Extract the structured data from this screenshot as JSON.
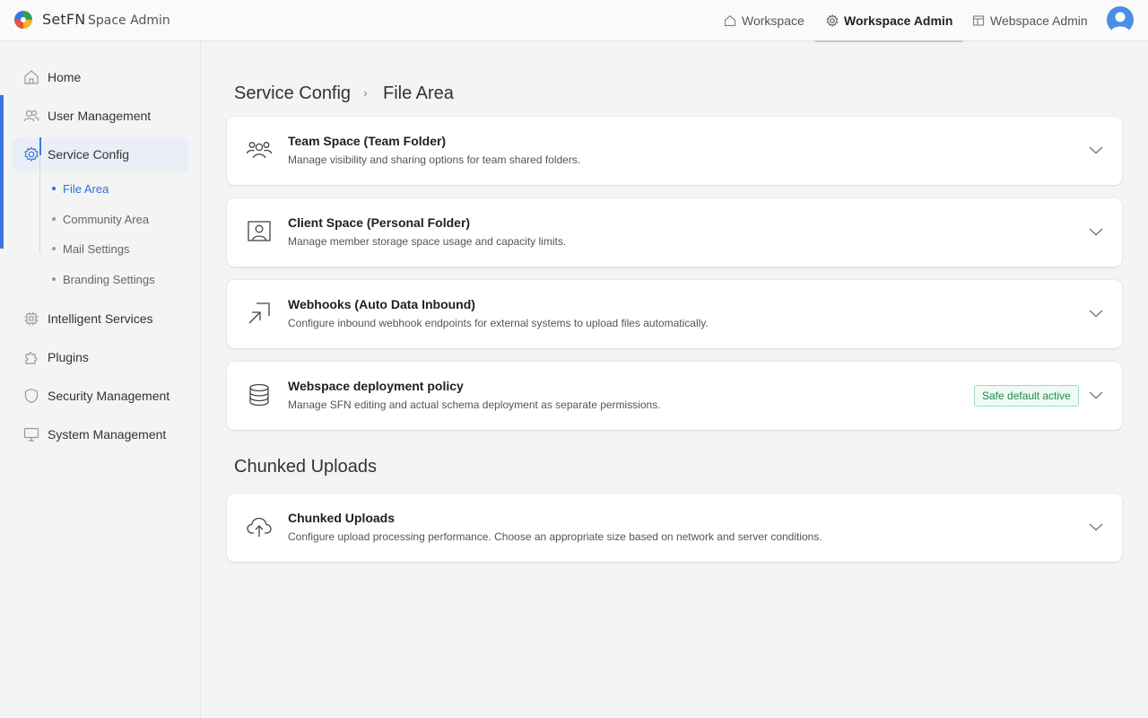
{
  "header": {
    "brand": "SetFN",
    "subtitle": "Space Admin",
    "nav": [
      {
        "label": "Workspace",
        "icon": "home-icon",
        "active": false
      },
      {
        "label": "Workspace Admin",
        "icon": "gear-icon",
        "active": true
      },
      {
        "label": "Webspace Admin",
        "icon": "layout-icon",
        "active": false
      }
    ],
    "avatar_icon": "user-avatar-icon"
  },
  "sidebar": {
    "items": [
      {
        "label": "Home",
        "icon": "home-icon"
      },
      {
        "label": "User Management",
        "icon": "users-icon"
      },
      {
        "label": "Service Config",
        "icon": "gear-icon",
        "active": true
      },
      {
        "label": "Intelligent Services",
        "icon": "chip-icon"
      },
      {
        "label": "Plugins",
        "icon": "puzzle-icon"
      },
      {
        "label": "Security Management",
        "icon": "shield-icon"
      },
      {
        "label": "System Management",
        "icon": "monitor-icon"
      }
    ],
    "sub_items": [
      {
        "label": "File Area",
        "active": true
      },
      {
        "label": "Community Area"
      },
      {
        "label": "Mail Settings"
      },
      {
        "label": "Branding Settings"
      }
    ]
  },
  "breadcrumb": {
    "parent": "Service Config",
    "separator": "›",
    "current": "File Area"
  },
  "cards": [
    {
      "title": "Team Space (Team Folder)",
      "description": "Manage visibility and sharing options for team shared folders.",
      "icon": "team-icon"
    },
    {
      "title": "Client Space (Personal Folder)",
      "description": "Manage member storage space usage and capacity limits.",
      "icon": "person-frame-icon"
    },
    {
      "title": "Webhooks (Auto Data Inbound)",
      "description": "Configure inbound webhook endpoints for external systems to upload files automatically.",
      "icon": "inbound-arrow-icon"
    },
    {
      "title": "Webspace deployment policy",
      "description": "Manage SFN editing and actual schema deployment as separate permissions.",
      "icon": "database-icon",
      "badge": "Safe default active"
    }
  ],
  "section": {
    "title": "Chunked Uploads",
    "card": {
      "title": "Chunked Uploads",
      "description": "Configure upload processing performance. Choose an appropriate size based on network and server conditions.",
      "icon": "cloud-upload-icon"
    }
  },
  "colors": {
    "accent": "#3b76e0",
    "badge_text": "#1e8a4c",
    "badge_bg": "#eefaf3",
    "background": "#f4f4f4"
  }
}
